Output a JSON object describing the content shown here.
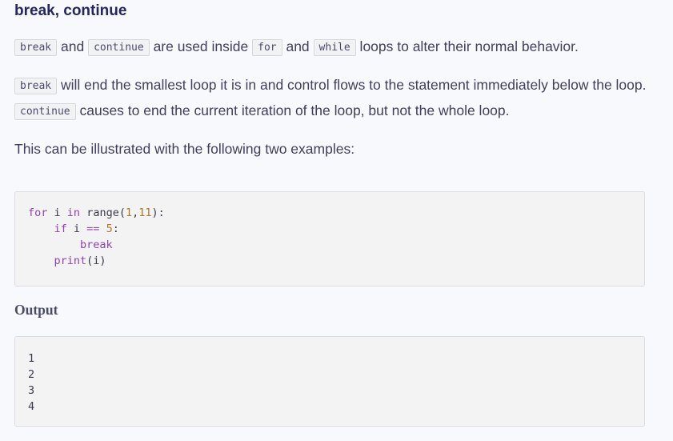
{
  "heading": "break, continue",
  "p1": {
    "c1": "break",
    "t1": " and ",
    "c2": "continue",
    "t2": " are used inside ",
    "c3": "for",
    "t3": " and ",
    "c4": "while",
    "t4": " loops to alter their normal behavior."
  },
  "p2": {
    "c1": "break",
    "t1": " will end the smallest loop it is in and control flows to the statement immediately below the loop. ",
    "c2": "continue",
    "t2": " causes to end the current iteration of the loop, but not the whole loop."
  },
  "p3": "This can be illustrated with the following two examples:",
  "code": {
    "l1_for": "for",
    "l1_i": " i ",
    "l1_in": "in",
    "l1_sp": " ",
    "l1_range": "range",
    "l1_open": "(",
    "l1_a": "1",
    "l1_comma": ",",
    "l1_b": "11",
    "l1_close": "):",
    "l2_indent": "    ",
    "l2_if": "if",
    "l2_i": " i ",
    "l2_eq": "==",
    "l2_sp": " ",
    "l2_five": "5",
    "l2_colon": ":",
    "l3_indent": "        ",
    "l3_break": "break",
    "l4_indent": "    ",
    "l4_print": "print",
    "l4_rest": "(i)"
  },
  "output_heading": "Output",
  "output_lines": [
    "1",
    "2",
    "3",
    "4"
  ]
}
